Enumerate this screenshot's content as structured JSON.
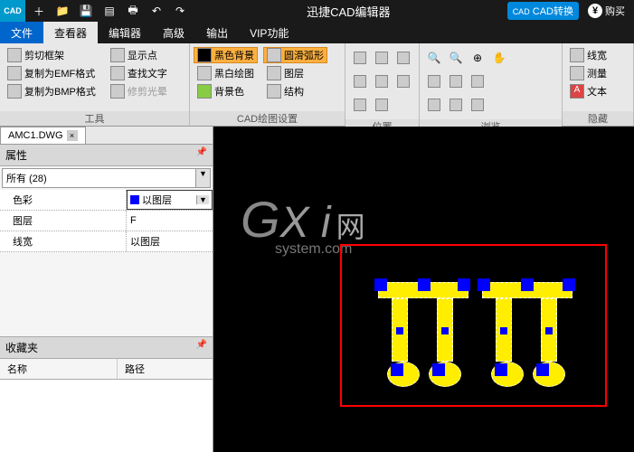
{
  "titlebar": {
    "logo": "CAD",
    "title": "迅捷CAD编辑器",
    "convert": "CAD转换",
    "buy": "购买"
  },
  "menu": {
    "file": "文件",
    "viewer": "查看器",
    "editor": "编辑器",
    "advanced": "高级",
    "output": "输出",
    "vip": "VIP功能"
  },
  "ribbon": {
    "tools": {
      "clipFrame": "剪切框架",
      "copyEMF": "复制为EMF格式",
      "copyBMP": "复制为BMP格式",
      "label": "工具"
    },
    "g2": {
      "showPoint": "显示点",
      "findText": "查找文字",
      "trimHalo": "修剪光晕"
    },
    "draw": {
      "blackBg": "黑色背景",
      "bwDraw": "黑白绘图",
      "bgColor": "背景色",
      "smoothArc": "圆滑弧形",
      "layer": "图层",
      "structure": "结构",
      "label": "CAD绘图设置"
    },
    "pos": {
      "label": "位置"
    },
    "browse": {
      "label": "浏览"
    },
    "hide": {
      "lineWidth": "线宽",
      "measure": "测量",
      "text": "文本",
      "label": "隐藏"
    }
  },
  "filetab": "AMC1.DWG",
  "props": {
    "header": "属性",
    "all": "所有 (28)",
    "color": {
      "k": "色彩",
      "v": "以图层"
    },
    "layer": {
      "k": "图层",
      "v": "F"
    },
    "lineWidth": {
      "k": "线宽",
      "v": "以图层"
    }
  },
  "fav": {
    "header": "收藏夹",
    "name": "名称",
    "path": "路径"
  },
  "watermark": {
    "g": "G",
    "x": "X i",
    "w": "网",
    "sys": "system.com"
  }
}
